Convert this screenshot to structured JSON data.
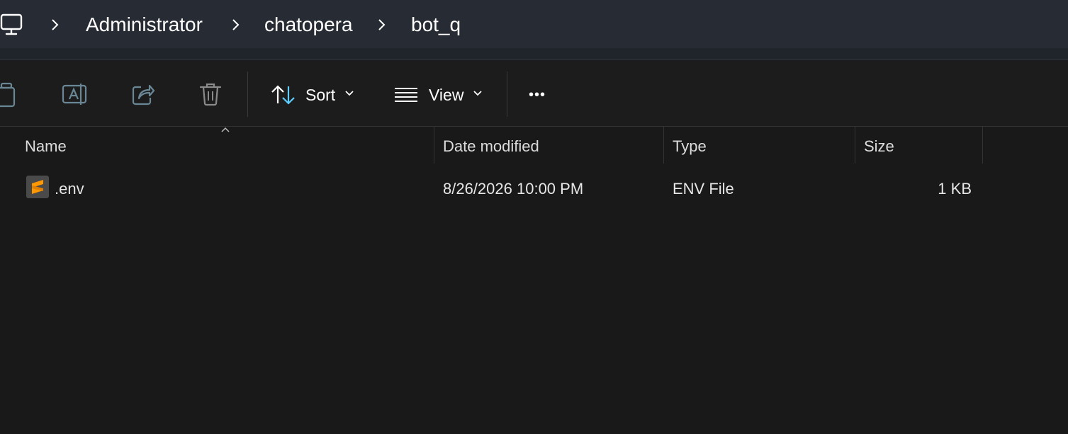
{
  "breadcrumb": {
    "root_icon": "computer-icon",
    "items": [
      "Administrator",
      "chatopera",
      "bot_q"
    ]
  },
  "toolbar": {
    "icons": [
      "copy-icon",
      "rename-icon",
      "share-icon",
      "delete-icon"
    ],
    "sort_label": "Sort",
    "view_label": "View",
    "more_label": "•••"
  },
  "columns": {
    "name": "Name",
    "date_modified": "Date modified",
    "type": "Type",
    "size": "Size"
  },
  "files": [
    {
      "name": ".env",
      "date_modified": "8/26/2026 10:00 PM",
      "type": "ENV File",
      "size": "1 KB",
      "icon": "sublime-text-icon"
    }
  ],
  "colors": {
    "accent": "#60cdff",
    "sublime_orange": "#ff9800",
    "background": "#191919",
    "address_bar": "#272b33"
  }
}
